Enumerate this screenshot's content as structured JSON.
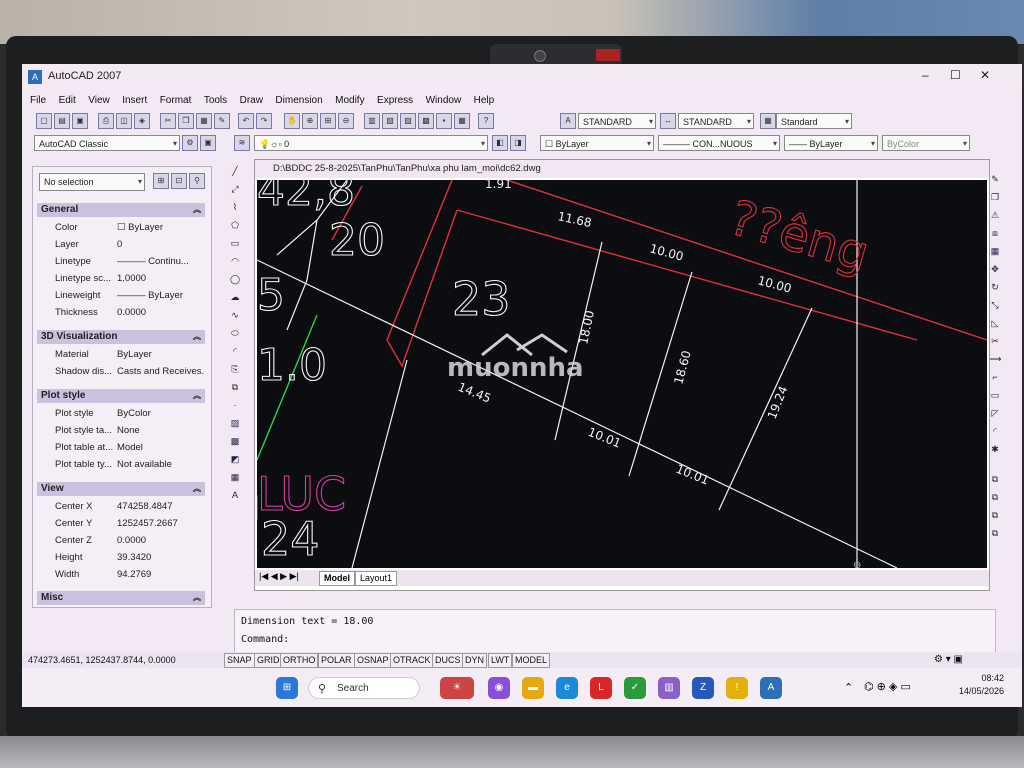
{
  "window": {
    "title": "AutoCAD 2007",
    "controls": [
      "–",
      "☐",
      "✕"
    ]
  },
  "menu": [
    "File",
    "Edit",
    "View",
    "Insert",
    "Format",
    "Tools",
    "Draw",
    "Dimension",
    "Modify",
    "Express",
    "Window",
    "Help"
  ],
  "toolbar": {
    "text_style": "STANDARD",
    "dim_style": "STANDARD",
    "table_style": "Standard",
    "workspace": "AutoCAD Classic",
    "layer": "0",
    "color": "ByLayer",
    "linetype": "CON...NUOUS",
    "lineweight": "ByLayer",
    "plotstyle": "ByColor"
  },
  "properties": {
    "selection": "No selection",
    "general": {
      "title": "General",
      "rows": [
        {
          "k": "Color",
          "v": "☐ ByLayer"
        },
        {
          "k": "Layer",
          "v": "0"
        },
        {
          "k": "Linetype",
          "v": "——— Continu..."
        },
        {
          "k": "Linetype sc...",
          "v": "1.0000"
        },
        {
          "k": "Lineweight",
          "v": "——— ByLayer"
        },
        {
          "k": "Thickness",
          "v": "0.0000"
        }
      ]
    },
    "viz3d": {
      "title": "3D Visualization",
      "rows": [
        {
          "k": "Material",
          "v": "ByLayer"
        },
        {
          "k": "Shadow dis...",
          "v": "Casts and Receives..."
        }
      ]
    },
    "plotstyle": {
      "title": "Plot style",
      "rows": [
        {
          "k": "Plot style",
          "v": "ByColor"
        },
        {
          "k": "Plot style ta...",
          "v": "None"
        },
        {
          "k": "Plot table at...",
          "v": "Model"
        },
        {
          "k": "Plot table ty...",
          "v": "Not available"
        }
      ]
    },
    "view": {
      "title": "View",
      "rows": [
        {
          "k": "Center X",
          "v": "474258.4847"
        },
        {
          "k": "Center Y",
          "v": "1252457.2667"
        },
        {
          "k": "Center Z",
          "v": "0.0000"
        },
        {
          "k": "Height",
          "v": "39.3420"
        },
        {
          "k": "Width",
          "v": "94.2769"
        }
      ]
    },
    "misc": {
      "title": "Misc"
    }
  },
  "drawing": {
    "path": "D:\\BDDC 25-8-2025\\TanPhu\\TanPhu\\xa phu lam_moi\\dc62.dwg",
    "labels": {
      "dim_191": "1.91",
      "dim_1168": "11.68",
      "dim_1000a": "10.00",
      "dim_1000b": "10.00",
      "dim_1800": "18.00",
      "dim_1860": "18.60",
      "dim_1924": "19.24",
      "dim_1001a": "10.01",
      "dim_1001b": "10.01",
      "dim_1445": "14.45",
      "lot_23": "23",
      "lot_20": "20",
      "lot_24": "24",
      "lot_10": "1.0",
      "lot_5": "5",
      "lot_42": "42,8",
      "road_text": "??êng",
      "luc_text": "LUC",
      "watermark": "muonnha"
    },
    "tabs": [
      "Model",
      "Layout1"
    ]
  },
  "command": {
    "line1": "Dimension text = 18.00",
    "line2": "Command:"
  },
  "status": {
    "coords": "474273.4651, 1252437.8744, 0.0000",
    "buttons": [
      "SNAP",
      "GRID",
      "ORTHO",
      "POLAR",
      "OSNAP",
      "OTRACK",
      "DUCS",
      "DYN",
      "LWT",
      "MODEL"
    ]
  },
  "taskbar": {
    "search": "Search",
    "time": "08:42",
    "date": "14/05/2026"
  }
}
